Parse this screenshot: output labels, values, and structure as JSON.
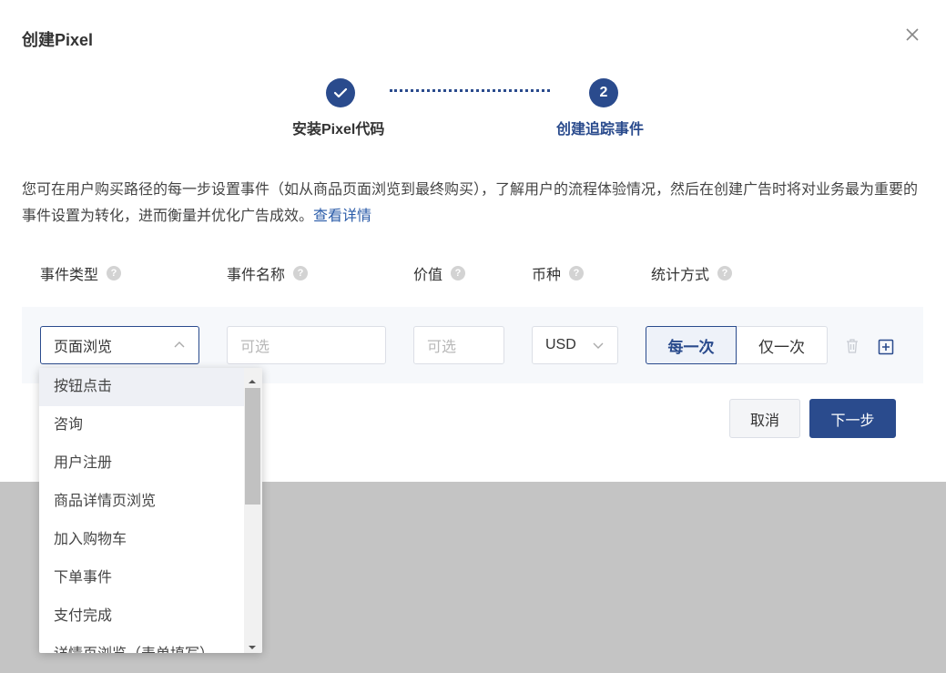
{
  "modal": {
    "title": "创建Pixel",
    "close_icon": "close-icon"
  },
  "steps": [
    {
      "label": "安装Pixel代码",
      "status": "done",
      "icon": "check-icon"
    },
    {
      "label": "创建追踪事件",
      "status": "current",
      "number": "2"
    }
  ],
  "description": {
    "text": "您可在用户购买路径的每一步设置事件（如从商品页面浏览到最终购买），了解用户的流程体验情况，然后在创建广告时将对业务最为重要的事件设置为转化，进而衡量并优化广告成效。",
    "link": "查看详情"
  },
  "columns": [
    {
      "label": "事件类型"
    },
    {
      "label": "事件名称"
    },
    {
      "label": "价值"
    },
    {
      "label": "币种"
    },
    {
      "label": "统计方式"
    }
  ],
  "help_glyph": "?",
  "row": {
    "event_type_value": "页面浏览",
    "event_name_placeholder": "可选",
    "value_placeholder": "可选",
    "currency_value": "USD",
    "count_options": [
      "每一次",
      "仅一次"
    ],
    "count_selected": "每一次",
    "delete_icon": "trash-icon",
    "add_icon": "plus-square-icon"
  },
  "buttons": {
    "cancel": "取消",
    "next": "下一步"
  },
  "dropdown": {
    "items": [
      "按钮点击",
      "咨询",
      "用户注册",
      "商品详情页浏览",
      "加入购物车",
      "下单事件",
      "支付完成",
      "详情页浏览（表单填写）"
    ],
    "hovered": "按钮点击"
  },
  "colors": {
    "primary": "#2a4b8d",
    "link": "#2a5ba8",
    "overlay": "#c4c4c4"
  }
}
